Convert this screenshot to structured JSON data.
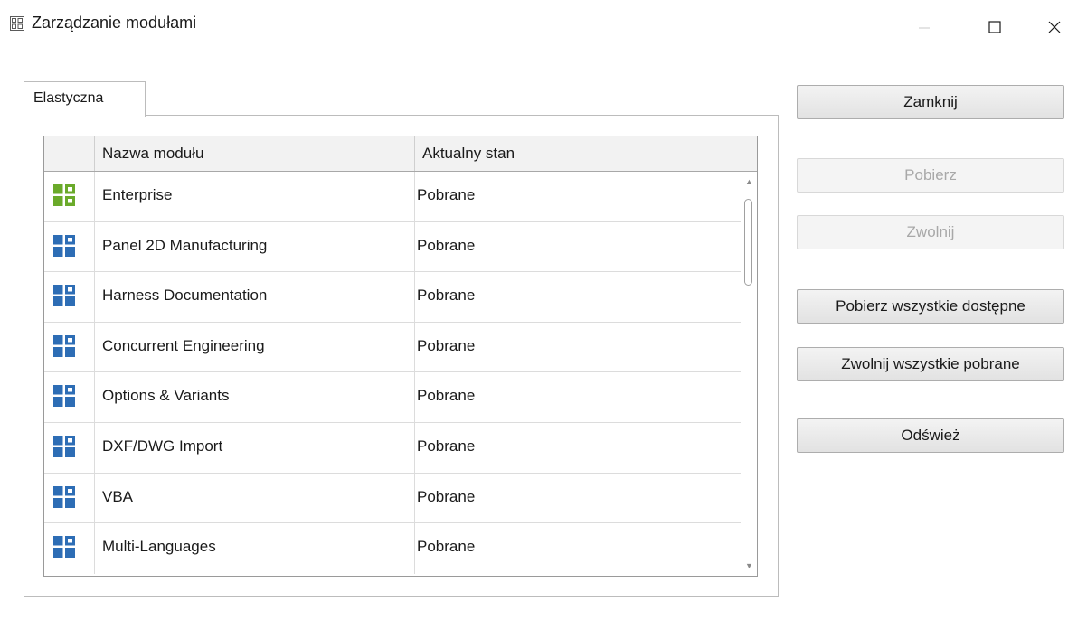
{
  "window": {
    "title": "Zarządzanie modułami",
    "controls": [
      "minimize-icon",
      "maximize-icon",
      "close-icon"
    ]
  },
  "tabs": [
    {
      "label": "Elastyczna",
      "active": true
    }
  ],
  "grid": {
    "columns": {
      "name": "Nazwa modułu",
      "state": "Aktualny stan"
    },
    "rows": [
      {
        "icon": "module-icon-green",
        "name": "Enterprise",
        "state": "Pobrane"
      },
      {
        "icon": "module-icon-blue",
        "name": "Panel 2D Manufacturing",
        "state": "Pobrane"
      },
      {
        "icon": "module-icon-blue",
        "name": "Harness Documentation",
        "state": "Pobrane"
      },
      {
        "icon": "module-icon-blue",
        "name": "Concurrent Engineering",
        "state": "Pobrane"
      },
      {
        "icon": "module-icon-blue",
        "name": "Options & Variants",
        "state": "Pobrane"
      },
      {
        "icon": "module-icon-blue",
        "name": "DXF/DWG Import",
        "state": "Pobrane"
      },
      {
        "icon": "module-icon-blue",
        "name": "VBA",
        "state": "Pobrane"
      },
      {
        "icon": "module-icon-blue",
        "name": "Multi-Languages",
        "state": "Pobrane"
      }
    ]
  },
  "buttons": {
    "close": "Zamknij",
    "get": "Pobierz",
    "release": "Zwolnij",
    "get_all": "Pobierz wszystkie dostępne",
    "release_all": "Zwolnij wszystkie pobrane",
    "refresh": "Odśwież"
  },
  "colors": {
    "module_green": "#6aaa2a",
    "module_blue": "#2d6db5",
    "disabled_text": "#a8a8a8"
  }
}
